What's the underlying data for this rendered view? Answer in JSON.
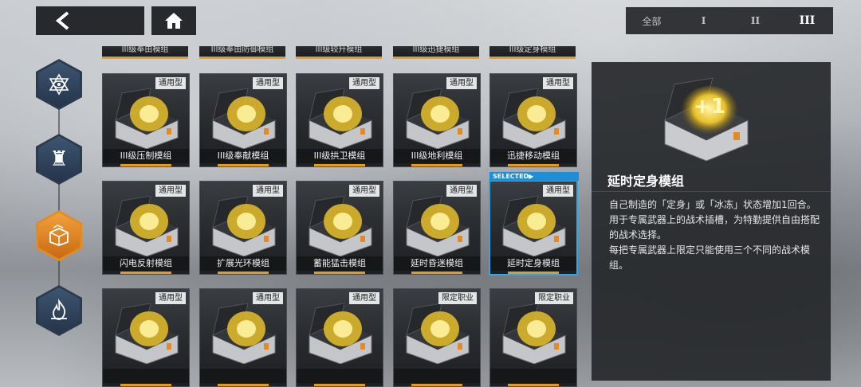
{
  "topbar": {
    "back_icon": "chevron-left-icon",
    "home_icon": "home-icon",
    "tiers": [
      "全部",
      "I",
      "II",
      "III"
    ],
    "active_tier": "III"
  },
  "side_nav": [
    {
      "icon": "eye-star-icon",
      "active": false
    },
    {
      "icon": "chess-rook-icon",
      "active": false
    },
    {
      "icon": "box-icon",
      "active": true
    },
    {
      "icon": "flame-icon",
      "active": false
    }
  ],
  "partial_row": [
    "III级奉由模组",
    "III级奉由防御模组",
    "III级较升模组",
    "III级迅捷模组",
    "III级定身模组"
  ],
  "modules": [
    {
      "name": "III级压制模组",
      "tag": "通用型"
    },
    {
      "name": "III级奉献模组",
      "tag": "通用型"
    },
    {
      "name": "III级拱卫模组",
      "tag": "通用型"
    },
    {
      "name": "III级地利模组",
      "tag": "通用型"
    },
    {
      "name": "迅捷移动模组",
      "tag": "通用型"
    },
    {
      "name": "闪电反射模组",
      "tag": "通用型"
    },
    {
      "name": "扩展光环模组",
      "tag": "通用型"
    },
    {
      "name": "蓄能猛击模组",
      "tag": "通用型"
    },
    {
      "name": "延时昏迷模组",
      "tag": "通用型"
    },
    {
      "name": "延时定身模组",
      "tag": "通用型"
    },
    {
      "name": "",
      "tag": "通用型"
    },
    {
      "name": "",
      "tag": "通用型"
    },
    {
      "name": "",
      "tag": "通用型"
    },
    {
      "name": "",
      "tag": "限定职业"
    },
    {
      "name": "",
      "tag": "限定职业"
    }
  ],
  "selected_label": "SELECTED▶",
  "detail": {
    "title": "延时定身模组",
    "desc": [
      "自己制造的「定身」或「冰冻」状态增加1回合。",
      "用于专属武器上的战术插槽，为特勤提供自由搭配的战术选择。",
      "每把专属武器上限定只能使用三个不同的战术模组。"
    ]
  },
  "colors": {
    "accent": "#e59a1e",
    "selected": "#2fa7e6",
    "panel": "#26282b"
  }
}
